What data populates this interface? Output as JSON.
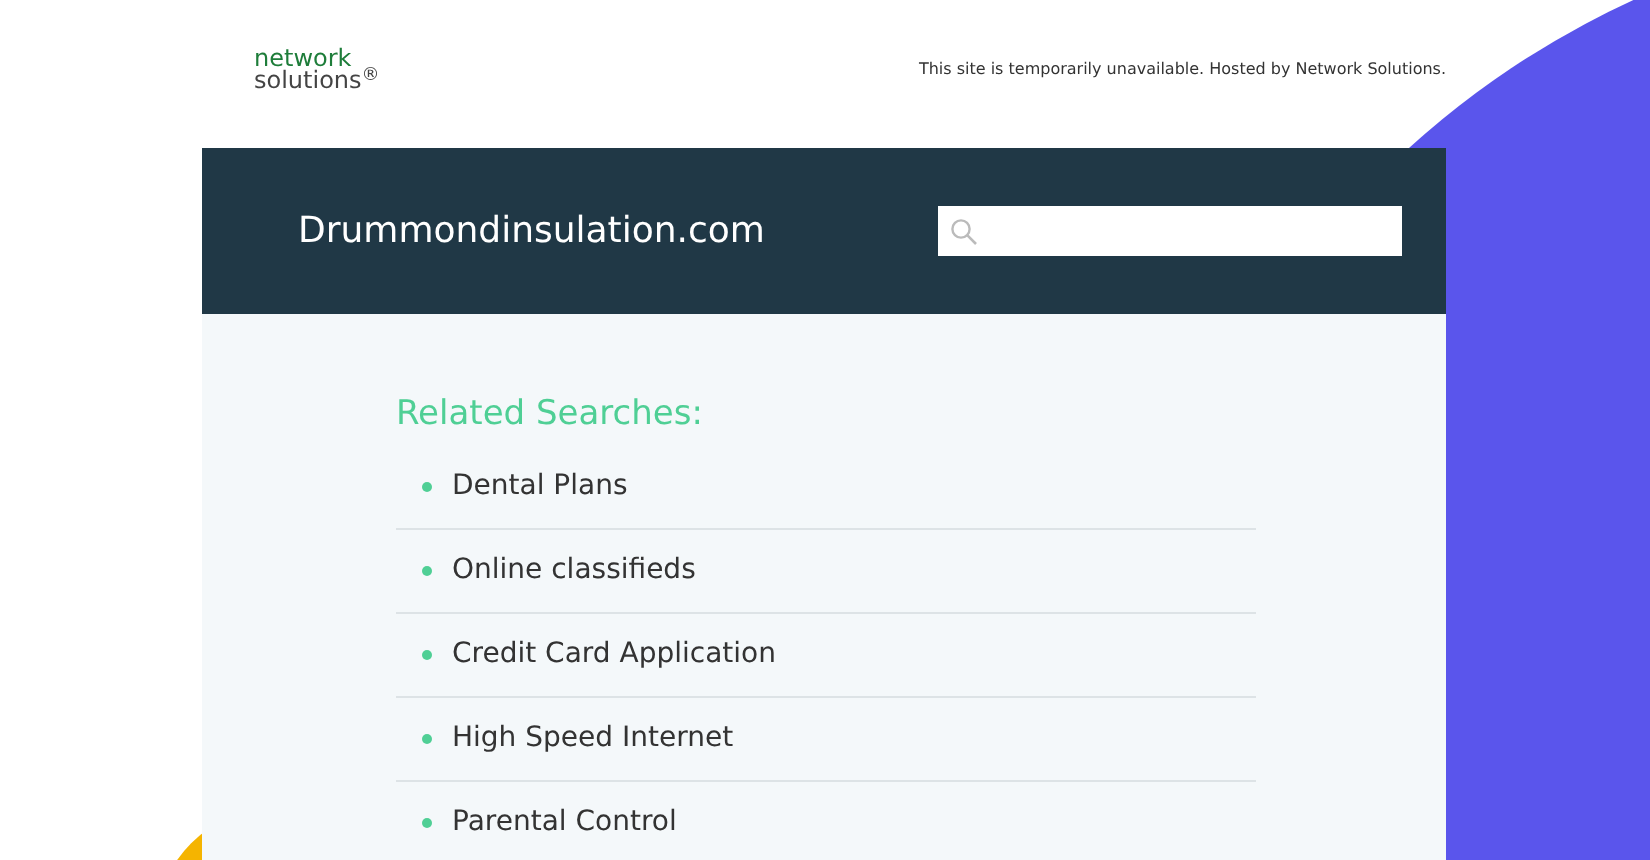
{
  "logo": {
    "line_1": "network",
    "line_2": "solutions$^{®}$"
  },
  "notice": "This site is temporarily unavailable. Hosted by Network Solutions.",
  "site_title": "Drummondinsulation.com",
  "related": {
    "heading": "Related Searches:",
    "items": [
      "Dental Plans",
      "Online classifieds",
      "Credit Card Application",
      "High Speed Internet",
      "Parental Control"
    ]
  }
}
